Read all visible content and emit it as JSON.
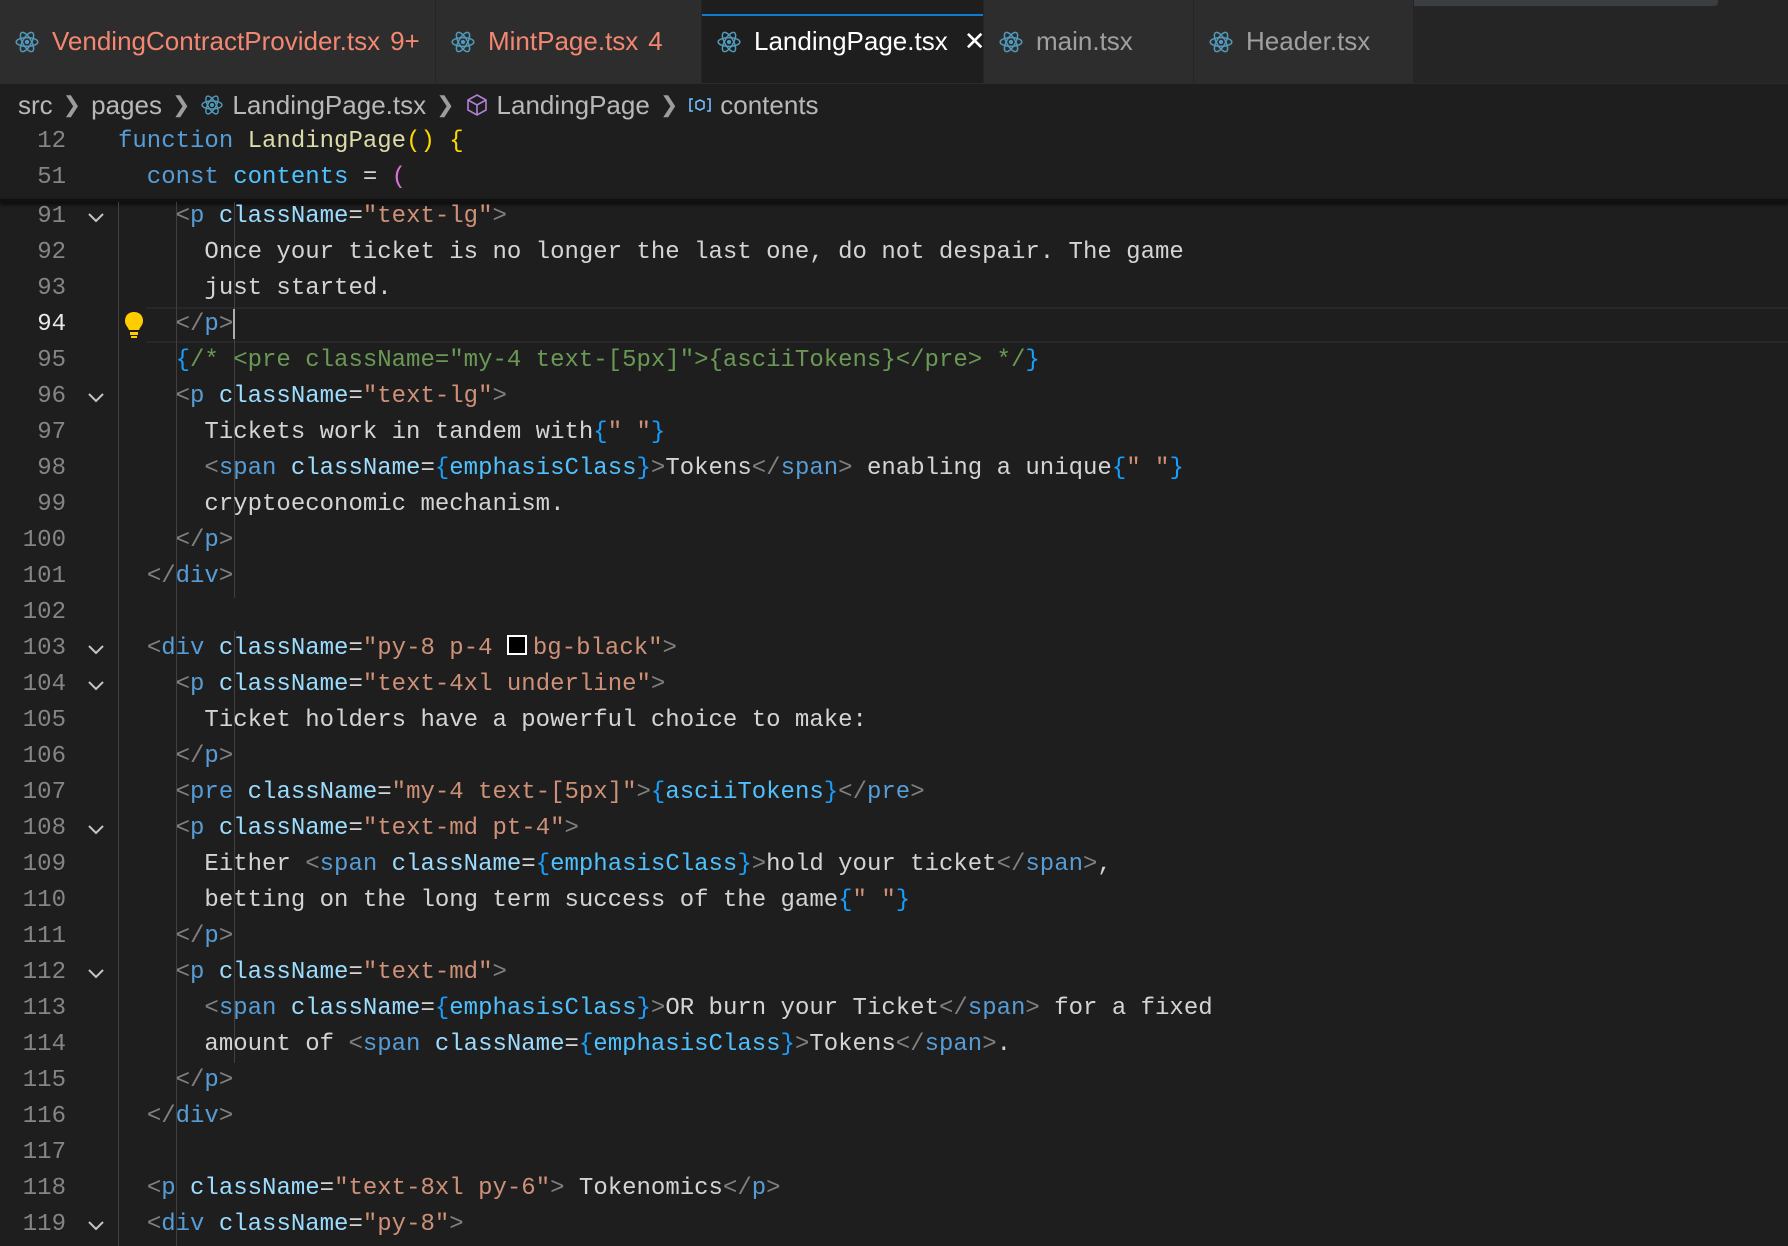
{
  "colors": {
    "modified_tab": "#f48771",
    "active_tab_indicator": "#0e7ad3",
    "keyword": "#569cd6",
    "string": "#ce9178",
    "attribute": "#9cdcfe",
    "comment": "#6a9955",
    "background": "#1e1e1e"
  },
  "tabs": [
    {
      "label": "VendingContractProvider.tsx",
      "badge": "9+",
      "icon": "react-icon",
      "state": "modified"
    },
    {
      "label": "MintPage.tsx",
      "badge": "4",
      "icon": "react-icon",
      "state": "modified"
    },
    {
      "label": "LandingPage.tsx",
      "badge": "",
      "icon": "react-icon",
      "state": "active",
      "close": "✕"
    },
    {
      "label": "main.tsx",
      "badge": "",
      "icon": "react-icon",
      "state": "normal"
    },
    {
      "label": "Header.tsx",
      "badge": "",
      "icon": "react-icon",
      "state": "normal"
    }
  ],
  "breadcrumb": {
    "items": [
      {
        "label": "src",
        "icon": ""
      },
      {
        "label": "pages",
        "icon": ""
      },
      {
        "label": "LandingPage.tsx",
        "icon": "react-icon"
      },
      {
        "label": "LandingPage",
        "icon": "cube-icon"
      },
      {
        "label": "contents",
        "icon": "variable-icon"
      }
    ]
  },
  "editor": {
    "current_line": "94",
    "sticky_lines": [
      {
        "num": "12",
        "tokens": [
          [
            "k",
            "function "
          ],
          [
            "fn",
            "LandingPage"
          ],
          [
            "br",
            "() {"
          ]
        ]
      },
      {
        "num": "51",
        "tokens": [
          [
            "k",
            "  const "
          ],
          [
            "v",
            "contents"
          ],
          [
            "pu",
            " = "
          ],
          [
            "pa",
            "("
          ]
        ]
      }
    ],
    "lines": [
      {
        "num": "91",
        "fold": true,
        "tokens": [
          [
            "tx",
            "    "
          ],
          [
            "t",
            "<"
          ],
          [
            "tg",
            "p"
          ],
          [
            "at",
            " className"
          ],
          [
            "pu",
            "="
          ],
          [
            "s",
            "\"text-lg\""
          ],
          [
            "t",
            ">"
          ]
        ]
      },
      {
        "num": "92",
        "fold": false,
        "tokens": [
          [
            "tx",
            "      Once your ticket is no longer the last one, do not despair. The game"
          ]
        ]
      },
      {
        "num": "93",
        "fold": false,
        "tokens": [
          [
            "tx",
            "      just started."
          ]
        ]
      },
      {
        "num": "94",
        "fold": false,
        "bulb": true,
        "cursor": true,
        "tokens": [
          [
            "tx",
            "    "
          ],
          [
            "t",
            "</"
          ],
          [
            "tg",
            "p"
          ],
          [
            "t",
            ">"
          ]
        ]
      },
      {
        "num": "95",
        "fold": false,
        "tokens": [
          [
            "tx",
            "    "
          ],
          [
            "cb",
            "{"
          ],
          [
            "c",
            "/* <pre className=\"my-4 text-[5px]\">{asciiTokens}</pre> */"
          ],
          [
            "cb",
            "}"
          ]
        ]
      },
      {
        "num": "96",
        "fold": true,
        "tokens": [
          [
            "tx",
            "    "
          ],
          [
            "t",
            "<"
          ],
          [
            "tg",
            "p"
          ],
          [
            "at",
            " className"
          ],
          [
            "pu",
            "="
          ],
          [
            "s",
            "\"text-lg\""
          ],
          [
            "t",
            ">"
          ]
        ]
      },
      {
        "num": "97",
        "fold": false,
        "tokens": [
          [
            "tx",
            "      Tickets work in tandem with"
          ],
          [
            "cb",
            "{"
          ],
          [
            "s",
            "\" \""
          ],
          [
            "cb",
            "}"
          ]
        ]
      },
      {
        "num": "98",
        "fold": false,
        "tokens": [
          [
            "tx",
            "      "
          ],
          [
            "t",
            "<"
          ],
          [
            "tg",
            "span"
          ],
          [
            "at",
            " className"
          ],
          [
            "pu",
            "="
          ],
          [
            "cb",
            "{"
          ],
          [
            "v",
            "emphasisClass"
          ],
          [
            "cb",
            "}"
          ],
          [
            "t",
            ">"
          ],
          [
            "tx",
            "Tokens"
          ],
          [
            "t",
            "</"
          ],
          [
            "tg",
            "span"
          ],
          [
            "t",
            ">"
          ],
          [
            "tx",
            " enabling a unique"
          ],
          [
            "cb",
            "{"
          ],
          [
            "s",
            "\" \""
          ],
          [
            "cb",
            "}"
          ]
        ]
      },
      {
        "num": "99",
        "fold": false,
        "tokens": [
          [
            "tx",
            "      cryptoeconomic mechanism."
          ]
        ]
      },
      {
        "num": "100",
        "fold": false,
        "tokens": [
          [
            "tx",
            "    "
          ],
          [
            "t",
            "</"
          ],
          [
            "tg",
            "p"
          ],
          [
            "t",
            ">"
          ]
        ]
      },
      {
        "num": "101",
        "fold": false,
        "tokens": [
          [
            "tx",
            "  "
          ],
          [
            "t",
            "</"
          ],
          [
            "tg",
            "div"
          ],
          [
            "t",
            ">"
          ]
        ]
      },
      {
        "num": "102",
        "fold": false,
        "tokens": []
      },
      {
        "num": "103",
        "fold": true,
        "swatch": true,
        "tokens": [
          [
            "tx",
            "  "
          ],
          [
            "t",
            "<"
          ],
          [
            "tg",
            "div"
          ],
          [
            "at",
            " className"
          ],
          [
            "pu",
            "="
          ],
          [
            "s",
            "\"py-8 p-4 "
          ],
          [
            "swatch",
            ""
          ],
          [
            "s",
            "bg-black\""
          ],
          [
            "t",
            ">"
          ]
        ]
      },
      {
        "num": "104",
        "fold": true,
        "tokens": [
          [
            "tx",
            "    "
          ],
          [
            "t",
            "<"
          ],
          [
            "tg",
            "p"
          ],
          [
            "at",
            " className"
          ],
          [
            "pu",
            "="
          ],
          [
            "s",
            "\"text-4xl underline\""
          ],
          [
            "t",
            ">"
          ]
        ]
      },
      {
        "num": "105",
        "fold": false,
        "tokens": [
          [
            "tx",
            "      Ticket holders have a powerful choice to make:"
          ]
        ]
      },
      {
        "num": "106",
        "fold": false,
        "tokens": [
          [
            "tx",
            "    "
          ],
          [
            "t",
            "</"
          ],
          [
            "tg",
            "p"
          ],
          [
            "t",
            ">"
          ]
        ]
      },
      {
        "num": "107",
        "fold": false,
        "tokens": [
          [
            "tx",
            "    "
          ],
          [
            "t",
            "<"
          ],
          [
            "tg",
            "pre"
          ],
          [
            "at",
            " className"
          ],
          [
            "pu",
            "="
          ],
          [
            "s",
            "\"my-4 text-[5px]\""
          ],
          [
            "t",
            ">"
          ],
          [
            "cb",
            "{"
          ],
          [
            "v",
            "asciiTokens"
          ],
          [
            "cb",
            "}"
          ],
          [
            "t",
            "</"
          ],
          [
            "tg",
            "pre"
          ],
          [
            "t",
            ">"
          ]
        ]
      },
      {
        "num": "108",
        "fold": true,
        "tokens": [
          [
            "tx",
            "    "
          ],
          [
            "t",
            "<"
          ],
          [
            "tg",
            "p"
          ],
          [
            "at",
            " className"
          ],
          [
            "pu",
            "="
          ],
          [
            "s",
            "\"text-md pt-4\""
          ],
          [
            "t",
            ">"
          ]
        ]
      },
      {
        "num": "109",
        "fold": false,
        "tokens": [
          [
            "tx",
            "      Either "
          ],
          [
            "t",
            "<"
          ],
          [
            "tg",
            "span"
          ],
          [
            "at",
            " className"
          ],
          [
            "pu",
            "="
          ],
          [
            "cb",
            "{"
          ],
          [
            "v",
            "emphasisClass"
          ],
          [
            "cb",
            "}"
          ],
          [
            "t",
            ">"
          ],
          [
            "tx",
            "hold your ticket"
          ],
          [
            "t",
            "</"
          ],
          [
            "tg",
            "span"
          ],
          [
            "t",
            ">"
          ],
          [
            "tx",
            ","
          ]
        ]
      },
      {
        "num": "110",
        "fold": false,
        "tokens": [
          [
            "tx",
            "      betting on the long term success of the game"
          ],
          [
            "cb",
            "{"
          ],
          [
            "s",
            "\" \""
          ],
          [
            "cb",
            "}"
          ]
        ]
      },
      {
        "num": "111",
        "fold": false,
        "tokens": [
          [
            "tx",
            "    "
          ],
          [
            "t",
            "</"
          ],
          [
            "tg",
            "p"
          ],
          [
            "t",
            ">"
          ]
        ]
      },
      {
        "num": "112",
        "fold": true,
        "tokens": [
          [
            "tx",
            "    "
          ],
          [
            "t",
            "<"
          ],
          [
            "tg",
            "p"
          ],
          [
            "at",
            " className"
          ],
          [
            "pu",
            "="
          ],
          [
            "s",
            "\"text-md\""
          ],
          [
            "t",
            ">"
          ]
        ]
      },
      {
        "num": "113",
        "fold": false,
        "tokens": [
          [
            "tx",
            "      "
          ],
          [
            "t",
            "<"
          ],
          [
            "tg",
            "span"
          ],
          [
            "at",
            " className"
          ],
          [
            "pu",
            "="
          ],
          [
            "cb",
            "{"
          ],
          [
            "v",
            "emphasisClass"
          ],
          [
            "cb",
            "}"
          ],
          [
            "t",
            ">"
          ],
          [
            "tx",
            "OR burn your Ticket"
          ],
          [
            "t",
            "</"
          ],
          [
            "tg",
            "span"
          ],
          [
            "t",
            ">"
          ],
          [
            "tx",
            " for a fixed"
          ]
        ]
      },
      {
        "num": "114",
        "fold": false,
        "tokens": [
          [
            "tx",
            "      amount of "
          ],
          [
            "t",
            "<"
          ],
          [
            "tg",
            "span"
          ],
          [
            "at",
            " className"
          ],
          [
            "pu",
            "="
          ],
          [
            "cb",
            "{"
          ],
          [
            "v",
            "emphasisClass"
          ],
          [
            "cb",
            "}"
          ],
          [
            "t",
            ">"
          ],
          [
            "tx",
            "Tokens"
          ],
          [
            "t",
            "</"
          ],
          [
            "tg",
            "span"
          ],
          [
            "t",
            ">"
          ],
          [
            "tx",
            "."
          ]
        ]
      },
      {
        "num": "115",
        "fold": false,
        "tokens": [
          [
            "tx",
            "    "
          ],
          [
            "t",
            "</"
          ],
          [
            "tg",
            "p"
          ],
          [
            "t",
            ">"
          ]
        ]
      },
      {
        "num": "116",
        "fold": false,
        "tokens": [
          [
            "tx",
            "  "
          ],
          [
            "t",
            "</"
          ],
          [
            "tg",
            "div"
          ],
          [
            "t",
            ">"
          ]
        ]
      },
      {
        "num": "117",
        "fold": false,
        "tokens": []
      },
      {
        "num": "118",
        "fold": false,
        "tokens": [
          [
            "tx",
            "  "
          ],
          [
            "t",
            "<"
          ],
          [
            "tg",
            "p"
          ],
          [
            "at",
            " className"
          ],
          [
            "pu",
            "="
          ],
          [
            "s",
            "\"text-8xl py-6\""
          ],
          [
            "t",
            ">"
          ],
          [
            "tx",
            " Tokenomics"
          ],
          [
            "t",
            "</"
          ],
          [
            "tg",
            "p"
          ],
          [
            "t",
            ">"
          ]
        ]
      },
      {
        "num": "119",
        "fold": true,
        "tokens": [
          [
            "tx",
            "  "
          ],
          [
            "t",
            "<"
          ],
          [
            "tg",
            "div"
          ],
          [
            "at",
            " className"
          ],
          [
            "pu",
            "="
          ],
          [
            "s",
            "\"py-8\""
          ],
          [
            "t",
            ">"
          ]
        ]
      }
    ]
  }
}
